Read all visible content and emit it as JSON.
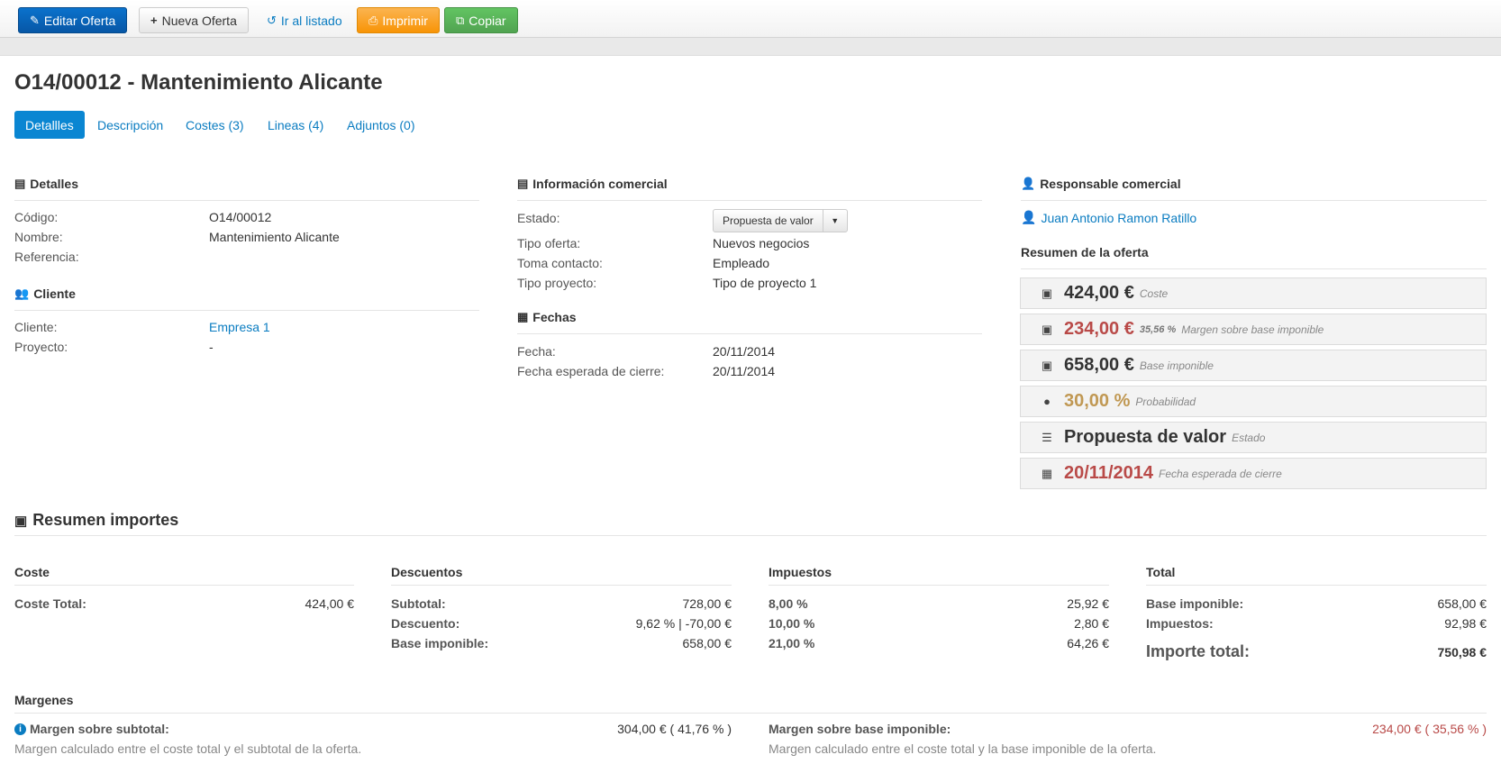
{
  "toolbar": {
    "edit_label": "Editar Oferta",
    "new_label": "Nueva Oferta",
    "list_label": "Ir al listado",
    "print_label": "Imprimir",
    "copy_label": "Copiar"
  },
  "page": {
    "title": "O14/00012 - Mantenimiento Alicante"
  },
  "tabs": [
    {
      "label": "Detallles"
    },
    {
      "label": "Descripción"
    },
    {
      "label": "Costes (3)"
    },
    {
      "label": "Lineas (4)"
    },
    {
      "label": "Adjuntos (0)"
    }
  ],
  "details": {
    "heading": "Detalles",
    "codigo_label": "Código:",
    "codigo_value": "O14/00012",
    "nombre_label": "Nombre:",
    "nombre_value": "Mantenimiento Alicante",
    "referencia_label": "Referencia:"
  },
  "client": {
    "heading": "Cliente",
    "cliente_label": "Cliente:",
    "cliente_value": "Empresa 1",
    "proyecto_label": "Proyecto:",
    "proyecto_value": "-"
  },
  "commercial": {
    "heading": "Información comercial",
    "estado_label": "Estado:",
    "estado_value": "Propuesta de valor",
    "tipo_oferta_label": "Tipo oferta:",
    "tipo_oferta_value": "Nuevos negocios",
    "toma_label": "Toma contacto:",
    "toma_value": "Empleado",
    "tipo_proyecto_label": "Tipo proyecto:",
    "tipo_proyecto_value": "Tipo de proyecto 1"
  },
  "dates": {
    "heading": "Fechas",
    "fecha_label": "Fecha:",
    "fecha_value": "20/11/2014",
    "cierre_label": "Fecha esperada de cierre:",
    "cierre_value": "20/11/2014"
  },
  "responsible": {
    "heading": "Responsable comercial",
    "name": "Juan Antonio Ramon Ratillo"
  },
  "summary": {
    "heading": "Resumen de la oferta",
    "coste_value": "424,00 €",
    "coste_label": "Coste",
    "margen_value": "234,00 €",
    "margen_pct": "35,56 %",
    "margen_label": "Margen sobre base imponible",
    "base_value": "658,00 €",
    "base_label": "Base imponible",
    "prob_value": "30,00 %",
    "prob_label": "Probabilidad",
    "estado_value": "Propuesta de valor",
    "estado_label": "Estado",
    "cierre_value": "20/11/2014",
    "cierre_label": "Fecha esperada de cierre",
    "colors": {
      "danger": "#b94a48",
      "warning": "#c09853"
    }
  },
  "amounts": {
    "heading": "Resumen importes",
    "coste": {
      "heading": "Coste",
      "total_label": "Coste Total:",
      "total_value": "424,00 €"
    },
    "descuentos": {
      "heading": "Descuentos",
      "subtotal_label": "Subtotal:",
      "subtotal_value": "728,00 €",
      "descuento_label": "Descuento:",
      "descuento_value": "9,62 % | -70,00 €",
      "base_label": "Base imponible:",
      "base_value": "658,00 €"
    },
    "impuestos": {
      "heading": "Impuestos",
      "rows": [
        {
          "label": "8,00 %",
          "value": "25,92 €"
        },
        {
          "label": "10,00 %",
          "value": "2,80 €"
        },
        {
          "label": "21,00 %",
          "value": "64,26 €"
        }
      ]
    },
    "total": {
      "heading": "Total",
      "base_label": "Base imponible:",
      "base_value": "658,00 €",
      "impuestos_label": "Impuestos:",
      "impuestos_value": "92,98 €",
      "importe_label": "Importe total:",
      "importe_value": "750,98 €"
    }
  },
  "margins": {
    "heading": "Margenes",
    "subtotal_label": "Margen sobre subtotal:",
    "subtotal_value": "304,00 € ( 41,76 % )",
    "subtotal_help": "Margen calculado entre el coste total y el subtotal de la oferta.",
    "base_label": "Margen sobre base imponible:",
    "base_value": "234,00 € ( 35,56 % )",
    "base_help": "Margen calculado entre el coste total y la base imponible de la oferta."
  }
}
